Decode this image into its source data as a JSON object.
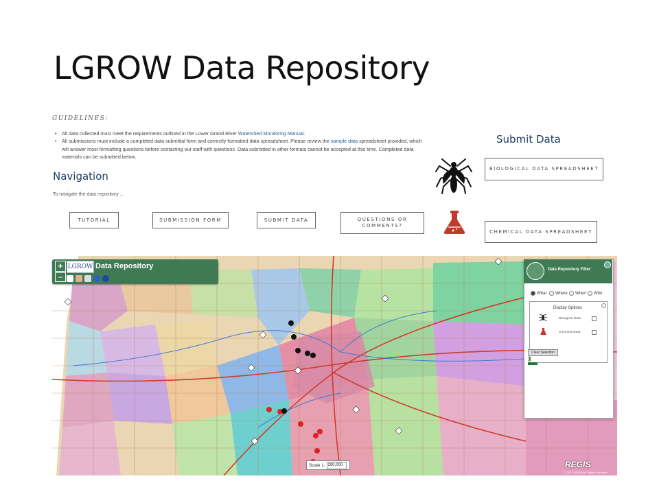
{
  "slide": {
    "title": "LGROW Data Repository"
  },
  "guidelines": {
    "heading": "GUIDELINES:",
    "item1_pre": "All data collected must meet the requirements outlined in the Lower Grand River ",
    "item1_link": "Watershed Monitoring Manual",
    "item1_post": ".",
    "item2_pre": "All submissions must include a completed data submittal form and correctly formatted data spreadsheet. Please review the ",
    "item2_link": "sample data",
    "item2_post": " spreadsheet provided, which will answer most formatting questions before contacting our staff with questions. Data submitted in other formats cannot be accepted at this time. Completed data materials can be submitted below."
  },
  "navigation": {
    "heading": "Navigation",
    "text": "To navigate the data repository ...",
    "buttons": [
      "TUTORIAL",
      "SUBMISSION FORM",
      "SUBMIT DATA",
      "QUESTIONS OR COMMENTS?"
    ]
  },
  "submit_data": {
    "heading": "Submit Data",
    "biological_button": "BIOLOGICAL DATA SPREADSHEET",
    "chemical_button": "CHEMICAL DATA SPREADSHEET",
    "biological_icon": "mosquito-icon",
    "chemical_icon": "flask-icon"
  },
  "map": {
    "logo_text": "LGROW",
    "title": "Data Repository",
    "zoom_in": "+",
    "zoom_out": "−",
    "filter": {
      "title": "Data Repository Filter",
      "radios": [
        "What",
        "Where",
        "When",
        "Who"
      ],
      "selected_radio": "What",
      "display_options_title": "Display Options",
      "options": [
        "Biological Data",
        "Chemical Data"
      ],
      "clear_button": "Clear Selection",
      "excel_label": "X"
    },
    "scale_label": "Scale 1:",
    "scale_value": "200,000",
    "brand": "REGIS",
    "copyright": "© 2017 REGIS All Rights Reserved",
    "colors": {
      "panel_green": "#3f7a54",
      "heading_blue": "#1d3d63",
      "flask_red": "#c0392b"
    }
  }
}
